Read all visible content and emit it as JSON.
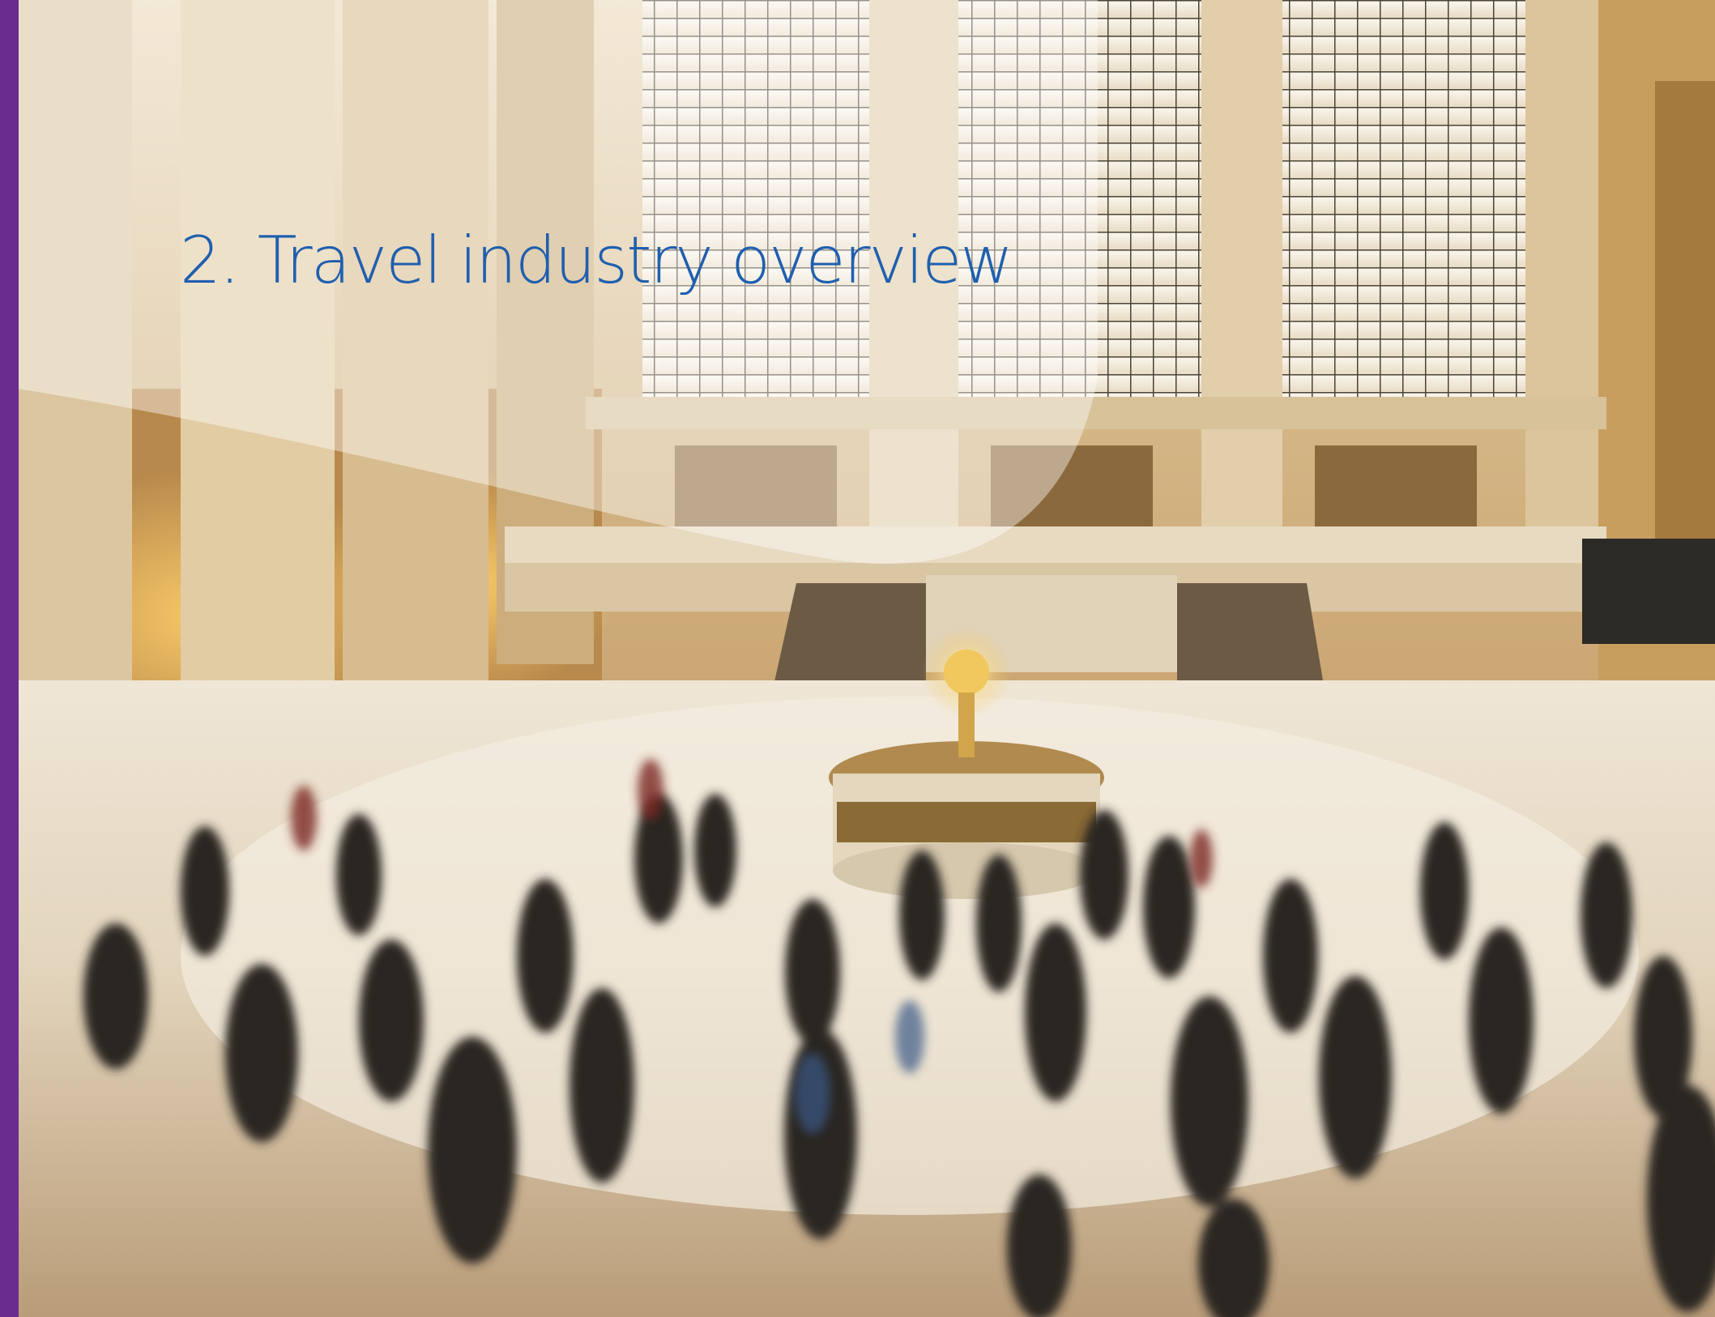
{
  "section": {
    "title": "2. Travel industry overview"
  },
  "colors": {
    "accent_bar": "#6a2c8f",
    "title_text": "#1f5fae",
    "overlay": "#ffffff"
  },
  "photo": {
    "subject": "photo"
  }
}
